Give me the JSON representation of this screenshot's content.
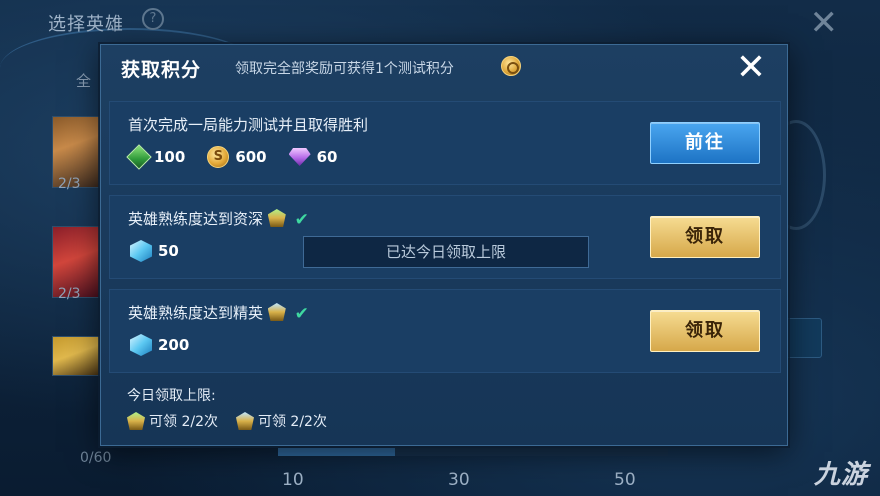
{
  "background": {
    "title": "选择英雄",
    "tab_label": "全",
    "hero_counts": [
      "2/3",
      "2/3"
    ],
    "progress_label": "0/60",
    "progress_fraction": 0.3,
    "milestones": [
      "10",
      "30",
      "50"
    ],
    "watermark": "九游"
  },
  "modal": {
    "title": "获取积分",
    "subtitle": "领取完全部奖励可获得1个测试积分",
    "close_label": "✕",
    "tasks": [
      {
        "title": "首次完成一局能力测试并且取得胜利",
        "rewards": [
          {
            "icon": "green-gem-icon",
            "value": "100"
          },
          {
            "icon": "gold-coin-icon",
            "value": "600"
          },
          {
            "icon": "purple-diamond-icon",
            "value": "60"
          }
        ],
        "button": "前往"
      },
      {
        "title": "英雄熟练度达到资深",
        "rewards": [
          {
            "icon": "blue-crystal-icon",
            "value": "50"
          }
        ],
        "button": "领取"
      },
      {
        "title": "英雄熟练度达到精英",
        "rewards": [
          {
            "icon": "blue-crystal-icon",
            "value": "200"
          }
        ],
        "button": "领取"
      }
    ],
    "toast": "已达今日领取上限",
    "daily_limit": {
      "label": "今日领取上限:",
      "items": [
        {
          "icon": "rank-badge-icon",
          "text": "可领 2/2次"
        },
        {
          "icon": "rank-badge-icon",
          "text": "可领 2/2次"
        }
      ]
    }
  },
  "colors": {
    "accent_blue": "#1d73c4",
    "accent_gold": "#d6a84a",
    "check_green": "#3fd8a0"
  }
}
